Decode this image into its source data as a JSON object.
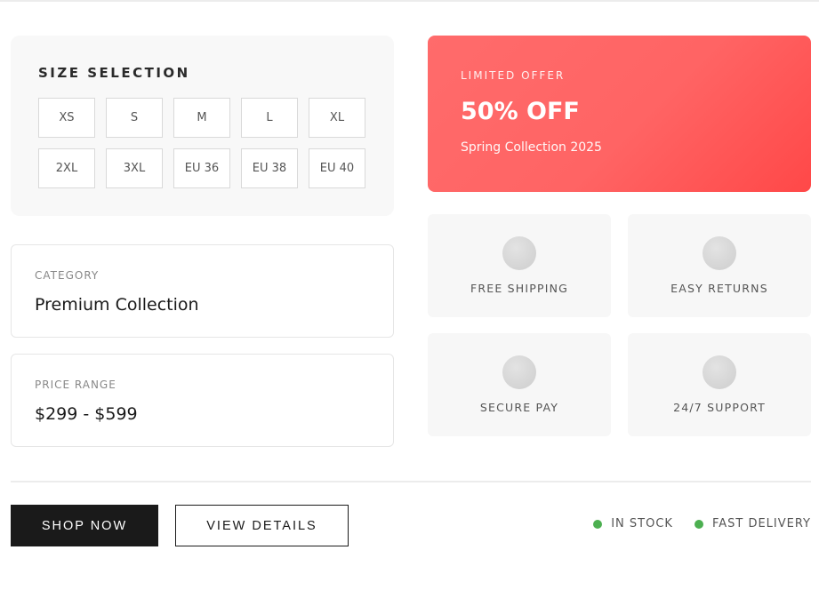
{
  "size_selection": {
    "title": "SIZE SELECTION",
    "sizes": [
      "XS",
      "S",
      "M",
      "L",
      "XL",
      "2XL",
      "3XL",
      "EU 36",
      "EU 38",
      "EU 40"
    ]
  },
  "category": {
    "label": "CATEGORY",
    "value": "Premium Collection"
  },
  "price_range": {
    "label": "PRICE RANGE",
    "value": "$299 - $599"
  },
  "offer": {
    "eyebrow": "LIMITED OFFER",
    "headline": "50% OFF",
    "subtitle": "Spring Collection 2025",
    "accent_color": "#ff5f5f"
  },
  "features": [
    {
      "label": "FREE SHIPPING",
      "icon": "shipping-icon"
    },
    {
      "label": "EASY RETURNS",
      "icon": "returns-icon"
    },
    {
      "label": "SECURE PAY",
      "icon": "secure-pay-icon"
    },
    {
      "label": "24/7 SUPPORT",
      "icon": "support-icon"
    }
  ],
  "actions": {
    "shop_now": "SHOP NOW",
    "view_details": "VIEW DETAILS"
  },
  "status": [
    {
      "label": "IN STOCK",
      "color": "#4caf50"
    },
    {
      "label": "FAST DELIVERY",
      "color": "#4caf50"
    }
  ]
}
